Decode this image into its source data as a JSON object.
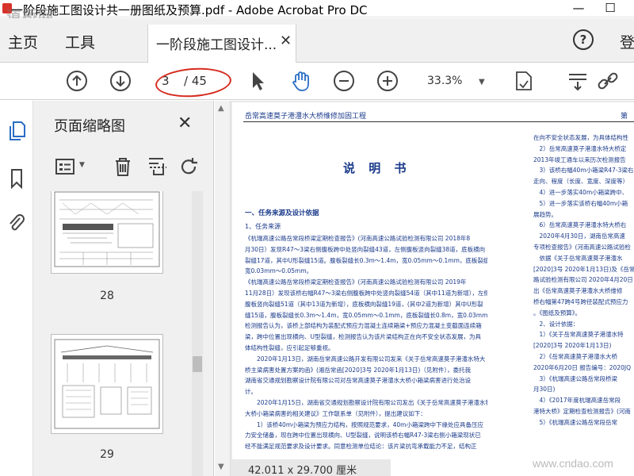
{
  "window": {
    "title": "一阶段施工图设计共一册图纸及预算.pdf - Adobe Acrobat Pro DC",
    "minimize": "—",
    "maximize": "☐",
    "watermark_logo": "道桥网"
  },
  "tabs": {
    "home": "主页",
    "tools": "工具",
    "document": "一阶段施工图设计...",
    "help": "?",
    "login": "登"
  },
  "toolbar": {
    "current_page": "3",
    "total_pages": "/ 45",
    "zoom": "33.3%"
  },
  "thumbnail_panel": {
    "title": "页面缩略图",
    "pages": [
      "28",
      "29"
    ]
  },
  "document": {
    "header": "岳常高速莫子港澧水大桥维修加固工程",
    "header_right": "第",
    "title": "说 明 书",
    "left_column": [
      {
        "style": "h1",
        "text": "一、任务来源及设计依据"
      },
      {
        "style": "h2",
        "text": "1、任务来源"
      },
      {
        "style": "p",
        "text": "《杭瑞高速公路岳常段桥梁定期检查报告》(河南高速公路试验检测有限公司 2018年8"
      },
      {
        "style": "p",
        "text": "月30日）发现R47～3梁右侧腹板跨中处竖向裂缝43道，左侧腹板竖向裂缝38道，底板横向"
      },
      {
        "style": "p",
        "text": "裂缝17道，其中U形裂缝15道。腹板裂缝长0.3m～1.4m，宽0.05mm～0.1mm，底板裂缝长0.8m，"
      },
      {
        "style": "p",
        "text": "宽0.03mm～0.05mm。"
      },
      {
        "style": "p",
        "text": "《杭瑞高速公路岳常段桥梁定期检查报告》(河南高速公路试验检测有限公司 2019年"
      },
      {
        "style": "p",
        "text": "11月28日）发现该桥右幅R47～3梁右侧腹板跨中处竖向裂缝54道（其中11道为新增），左侧"
      },
      {
        "style": "p",
        "text": "腹板竖向裂缝51道（其中13道为新增），底板横向裂缝19道，(其中2道为新增）其中U形裂"
      },
      {
        "style": "p",
        "text": "缝15道，腹板裂缝长0.3m～1.4m，宽0.05mm～0.1mm，底板裂缝长0.8m，宽0.03mm～0.05mm。"
      },
      {
        "style": "p",
        "text": "检测报告认为，该桥上部结构为装配式预应力混凝土连续箱梁+预应力混凝土变截面连续箱"
      },
      {
        "style": "p",
        "text": "梁，跨中位置出现横向、U型裂缝，检测报告认为该片梁结构正在向不安全状态发展，为具"
      },
      {
        "style": "p",
        "text": "体结构性裂缝，应引起足够重视。"
      },
      {
        "style": "p",
        "text": "　　2020年1月13日，湖南岳常高速公路开发有限公司发来《关于岳常高速莫子港澧水特大"
      },
      {
        "style": "p",
        "text": "桥主梁病害处置方案的函》(湘岳常函[2020]3号 2020年1月13日)（见附件），委托我"
      },
      {
        "style": "p",
        "text": "湖南省交通规划勘察设计院有限公司对岳常高速莫子港澧水大桥小箱梁病害进行处治设"
      },
      {
        "style": "p",
        "text": "计。"
      },
      {
        "style": "p",
        "text": "　　2020年1月15日，湖南省交通规划勘察设计院有限公司发出《关于岳常高速莫子港澧水特"
      },
      {
        "style": "p",
        "text": "大桥小箱梁病害的相关建议》工作联系单（见附件），提出建议如下："
      },
      {
        "style": "p",
        "text": "　　1）该桥40m小箱梁为预应力结构，按照规范要求，40m小箱梁跨中下缘处应具备压应"
      },
      {
        "style": "p",
        "text": "力安全储备，现在跨中位置出现横向、U型裂缝，说明该桥右幅R47-3梁右侧小箱梁现状已"
      },
      {
        "style": "p",
        "text": "经不能满足规范要求及设计要求。同意检测单位结论：该片梁抗弯承载能力不足，结构正"
      }
    ],
    "right_column": [
      "在向不安全状态发展，为具体结构性",
      "　2）岳常高速莫子港澧水特大桥定",
      "2013年竣工通车以来历次检测报告",
      "　3）该桥右幅40m小箱梁R47-3梁右",
      "走向、程度（长度、宽度、深度等）",
      "　4）进一步落实40m小箱梁跨中、",
      "　5）进一步落实该桥右幅40m小箱",
      "展趋势。",
      "　6）岳常高速莫子港澧水特大桥右",
      "　2020年4月30日，湖南岳常高速",
      "专项检查报告》(河南高速公路试验检",
      "　依据《关于岳常高速莫子港澧水",
      "[2020]3号 2020年1月13日)及《岳常",
      "路试验检测有限公司 2020年4月20日",
      "出《岳常高速莫子港澧水大桥维修",
      "桥右幅第47跨4号跨径装配式预应力",
      "。《图纸及预算》。",
      "　2、设计依据：",
      "　1）《关于岳常高速莫子港澧水特",
      "[2020]3号 2020年1月13日)",
      "　2）《岳常高速莫子港澧水大桥",
      "2020年6月20日 报告编号：2020JQ",
      "　3）《杭瑞高速公路岳常段桥梁",
      "月30日)",
      "　4）《2017年度杭瑞高速岳常段",
      "港特大桥》定期检查检测报告》(河南",
      "　5）《杭瑞高速公路岳常段岳常"
    ],
    "dimensions": "42.011 x 29.700 厘米"
  },
  "watermark_url": "www.cndao.com",
  "colors": {
    "accent_red": "#d62a1e",
    "doc_text": "#1a3a8a",
    "toolbar_bg": "#f0f0f0"
  }
}
